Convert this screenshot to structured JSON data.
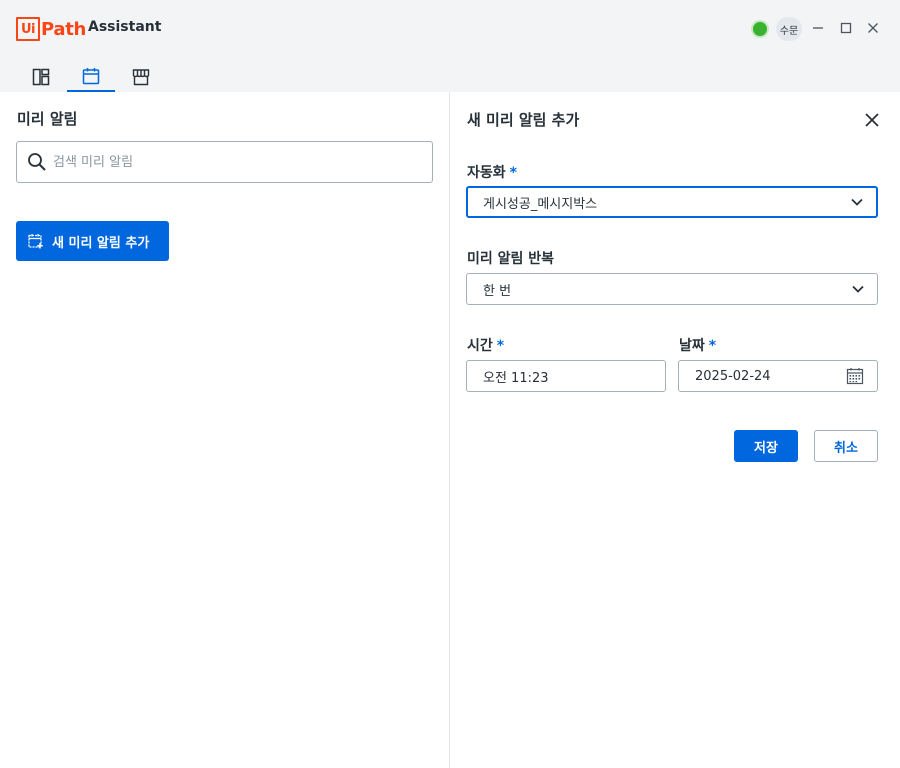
{
  "app": {
    "logo_box": "Ui",
    "logo_rest": "Path",
    "name": "Assistant"
  },
  "header": {
    "status_color": "#38b22f",
    "user_initials": "수문",
    "tabs": [
      {
        "icon": "dashboard-icon",
        "active": false
      },
      {
        "icon": "calendar-icon",
        "active": true
      },
      {
        "icon": "store-icon",
        "active": false
      }
    ]
  },
  "left": {
    "title": "미리 알림",
    "search_placeholder": "검색 미리 알림",
    "add_button_label": "새 미리 알림 추가"
  },
  "form": {
    "title": "새 미리 알림 추가",
    "automation_label": "자동화",
    "automation_value": "게시성공_메시지박스",
    "repeat_label": "미리 알림 반복",
    "repeat_value": "한 번",
    "time_label": "시간",
    "time_value": "오전 11:23",
    "date_label": "날짜",
    "date_value": "2025-02-24",
    "required_marker": "*",
    "save_label": "저장",
    "cancel_label": "취소"
  },
  "colors": {
    "brand": "#fa4616",
    "accent": "#0067df"
  }
}
